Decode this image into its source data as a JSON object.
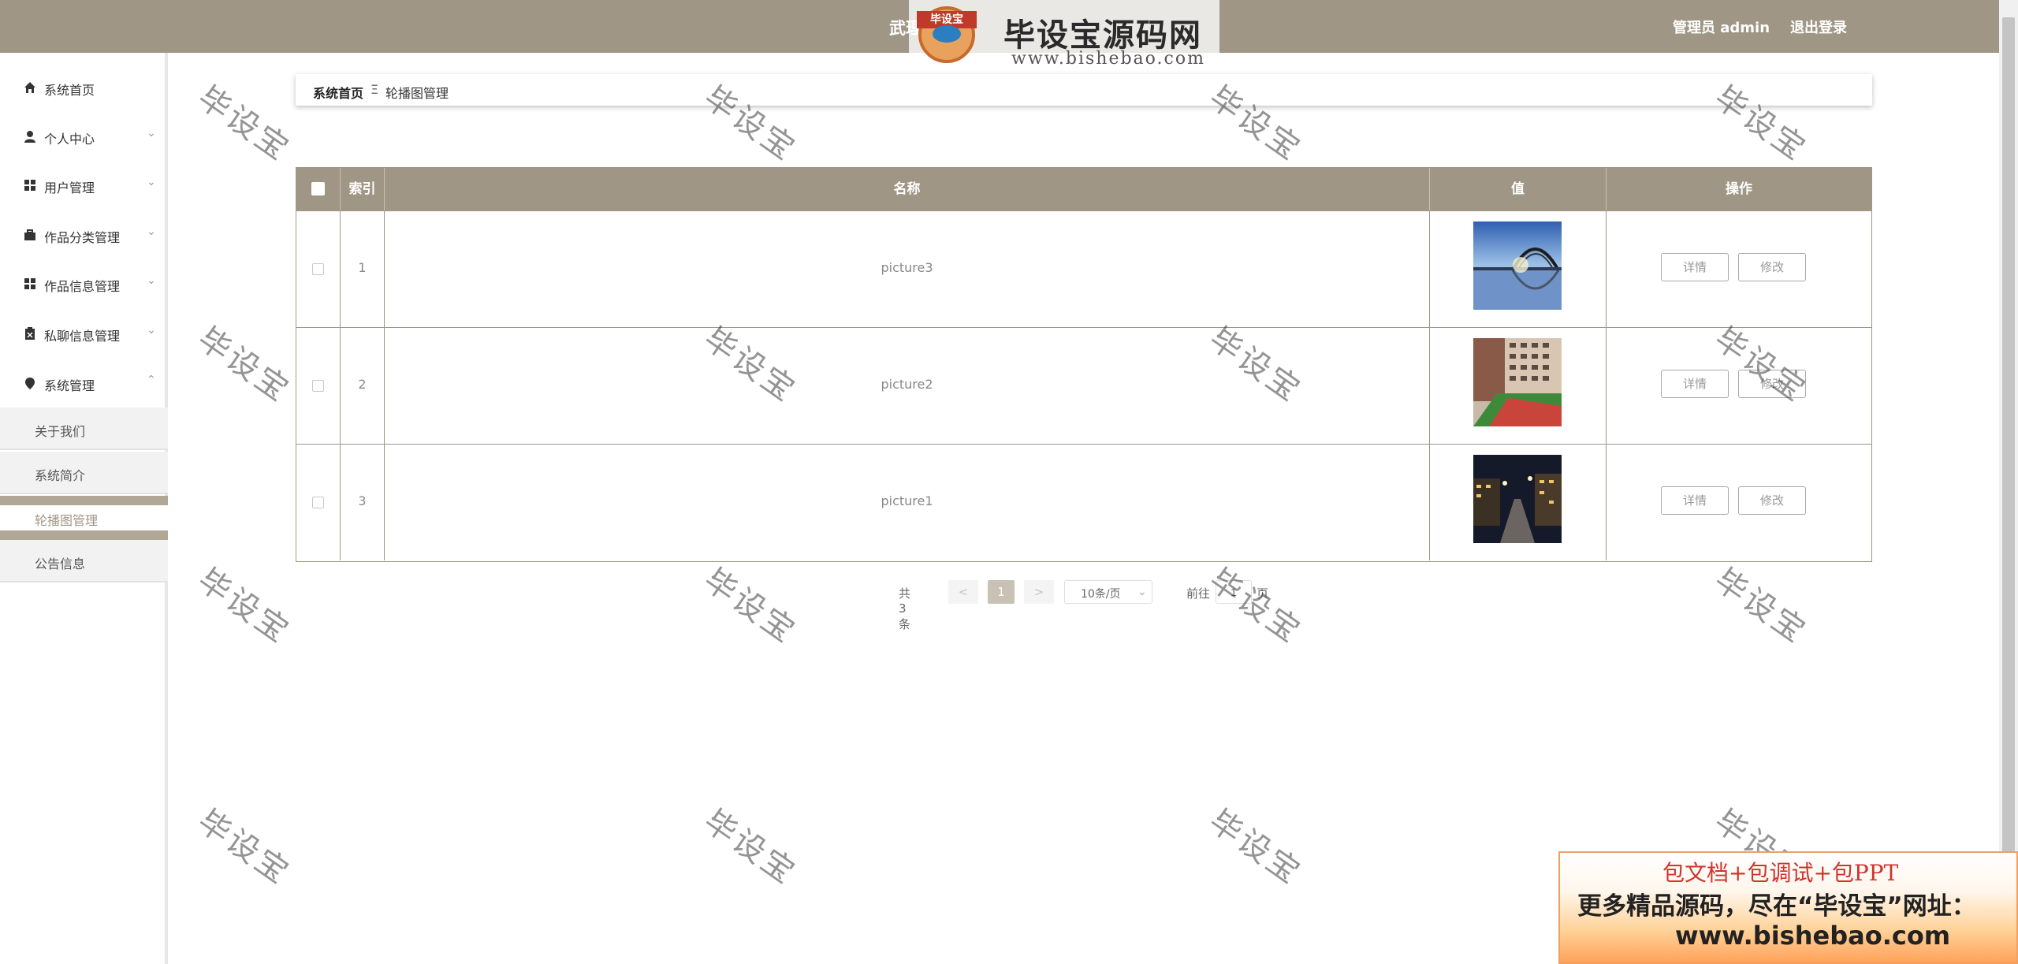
{
  "header": {
    "title": "武理",
    "admin_label": "管理员 admin",
    "logout_label": "退出登录"
  },
  "logo_watermark": {
    "badge_text": "毕设宝",
    "brand": "毕设宝源码网",
    "url": "www.bishebao.com"
  },
  "sidebar": {
    "items": [
      {
        "label": "系统首页",
        "icon": "home-icon"
      },
      {
        "label": "个人中心",
        "icon": "person-icon"
      },
      {
        "label": "用户管理",
        "icon": "grid-icon"
      },
      {
        "label": "作品分类管理",
        "icon": "briefcase-icon"
      },
      {
        "label": "作品信息管理",
        "icon": "grid-icon"
      },
      {
        "label": "私聊信息管理",
        "icon": "clipboard-icon"
      },
      {
        "label": "系统管理",
        "icon": "pin-icon"
      }
    ],
    "sub_items": [
      {
        "label": "关于我们"
      },
      {
        "label": "系统简介"
      },
      {
        "label": "轮播图管理"
      },
      {
        "label": "公告信息"
      }
    ],
    "active_sub": "轮播图管理"
  },
  "breadcrumb": {
    "home": "系统首页",
    "separator": "Ξ",
    "current": "轮播图管理"
  },
  "table": {
    "headers": {
      "index": "索引",
      "name": "名称",
      "value": "值",
      "actions": "操作"
    },
    "rows": [
      {
        "index": "1",
        "name": "picture3",
        "image": "bridge-lake-photo"
      },
      {
        "index": "2",
        "name": "picture2",
        "image": "building-courtyard-photo"
      },
      {
        "index": "3",
        "name": "picture1",
        "image": "night-street-photo"
      }
    ],
    "detail_label": "详情",
    "edit_label": "修改"
  },
  "pagination": {
    "total": "共 3 条",
    "prev": "<",
    "page": "1",
    "next": ">",
    "page_size": "10条/页",
    "goto_label": "前往",
    "goto_value": "1",
    "goto_suffix": "页"
  },
  "watermark_text": "毕设宝",
  "promo": {
    "line1": "包文档+包调试+包PPT",
    "line2": "更多精品源码，尽在“毕设宝”网址：",
    "line3": "www.bishebao.com"
  }
}
